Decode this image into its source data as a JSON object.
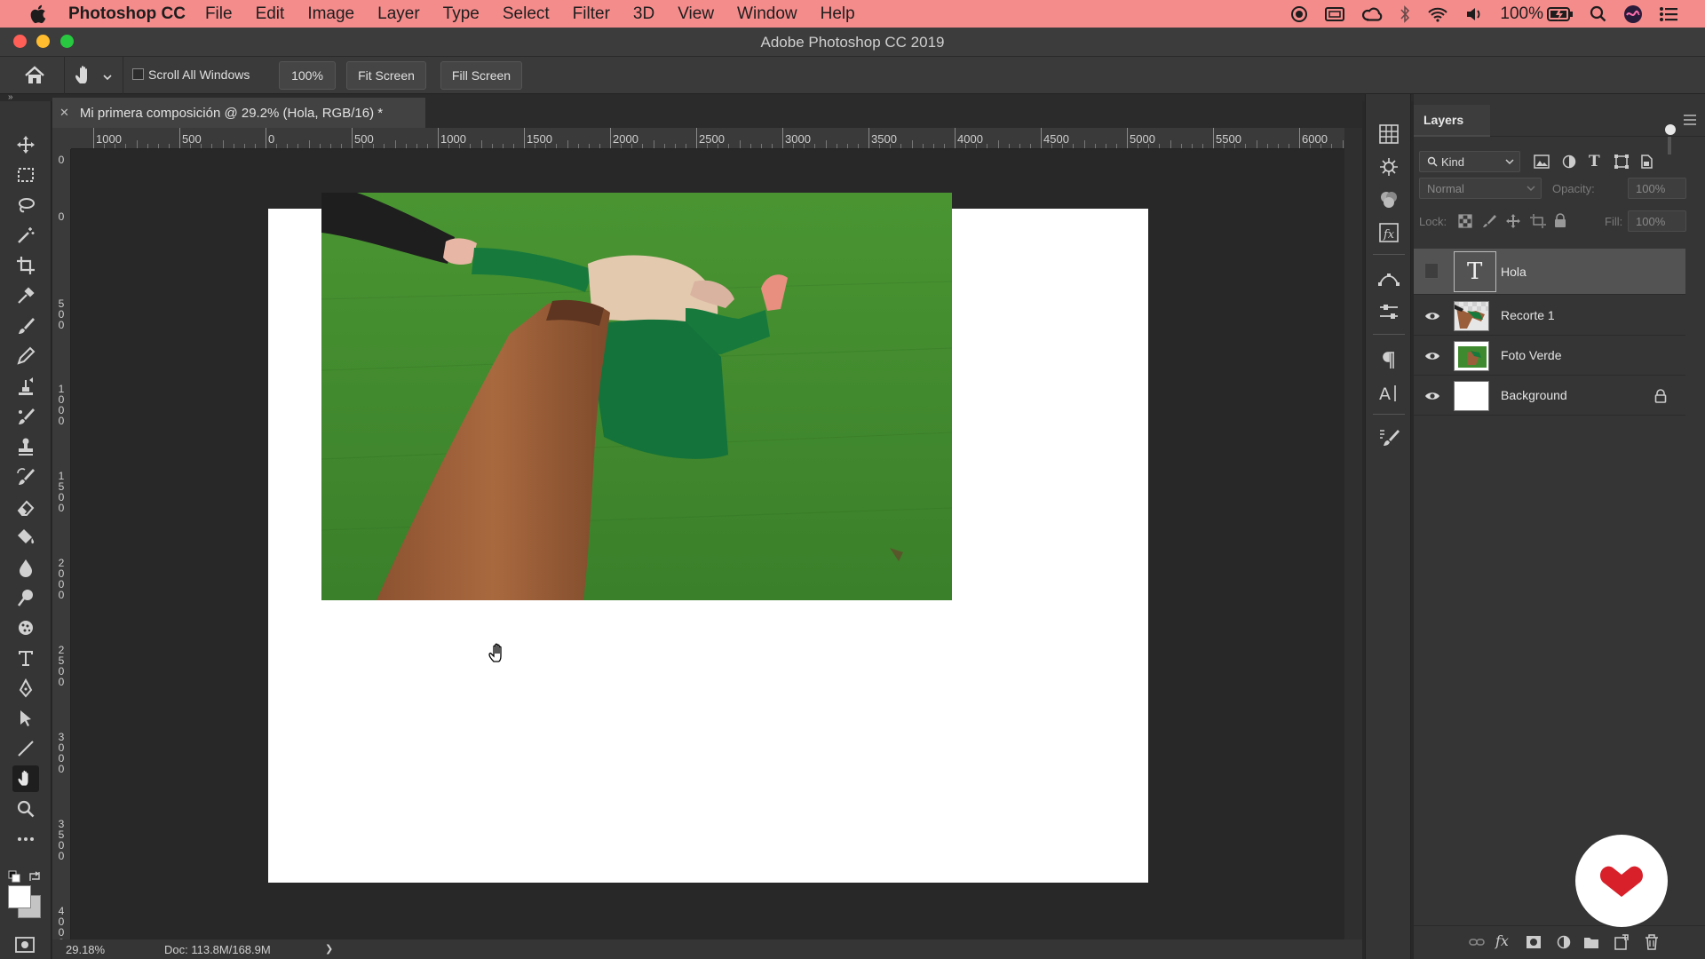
{
  "menubar": {
    "app_name": "Photoshop CC",
    "menus": [
      "File",
      "Edit",
      "Image",
      "Layer",
      "Type",
      "Select",
      "Filter",
      "3D",
      "View",
      "Window",
      "Help"
    ],
    "battery": "100%"
  },
  "window": {
    "title": "Adobe Photoshop CC 2019"
  },
  "options": {
    "scroll_all_windows": "Scroll All Windows",
    "zoom_value": "100%",
    "fit_screen": "Fit Screen",
    "fill_screen": "Fill Screen"
  },
  "document": {
    "tab_title": "Mi primera composición @ 29.2% (Hola, RGB/16) *"
  },
  "ruler": {
    "h_ticks": [
      "1000",
      "500",
      "0",
      "500",
      "1000",
      "1500",
      "2000",
      "2500",
      "3000",
      "3500",
      "4000",
      "4500",
      "5000",
      "5500",
      "6000"
    ],
    "v_ticks": [
      "0",
      "0",
      "500",
      "1000",
      "1500",
      "2000",
      "2500",
      "3000",
      "3500",
      "4000"
    ]
  },
  "status": {
    "zoom": "29.18%",
    "doc": "Doc: 113.8M/168.9M",
    "arrow": "❯"
  },
  "layers_panel": {
    "title": "Layers",
    "filter_kind": "Kind",
    "blend_mode": "Normal",
    "opacity_label": "Opacity:",
    "opacity_value": "100%",
    "lock_label": "Lock:",
    "fill_label": "Fill:",
    "fill_value": "100%",
    "layers": [
      {
        "name": "Hola",
        "visible": false,
        "type": "text",
        "selected": true
      },
      {
        "name": "Recorte 1",
        "visible": true,
        "type": "image"
      },
      {
        "name": "Foto Verde",
        "visible": true,
        "type": "image"
      },
      {
        "name": "Background",
        "visible": true,
        "type": "fill",
        "locked": true
      }
    ]
  },
  "colors": {
    "menubar": "#f58c8c",
    "grass": "#3f8a2e",
    "skirt": "#9b5e3a",
    "jacket": "#177a3c"
  }
}
